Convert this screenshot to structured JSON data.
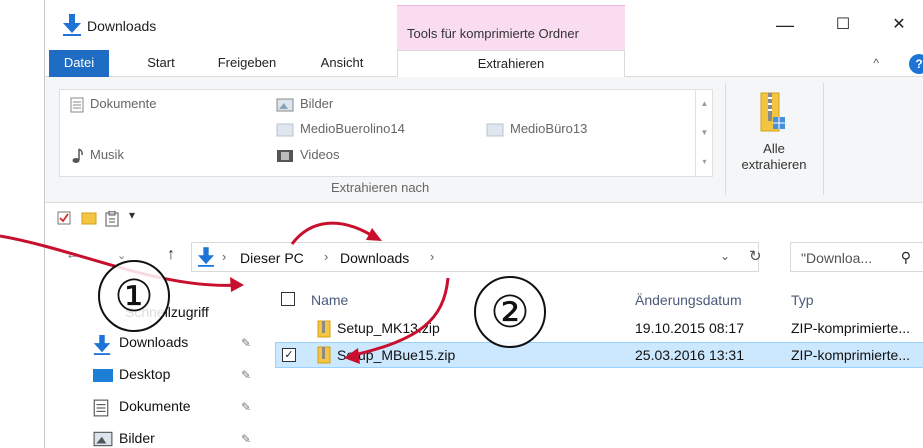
{
  "window": {
    "title": "Downloads",
    "context_tab": "Tools für komprimierte Ordner",
    "controls": {
      "minimize": "—",
      "maximize": "☐",
      "close": "✕"
    }
  },
  "ribbon_tabs": {
    "datei": "Datei",
    "start": "Start",
    "freigeben": "Freigeben",
    "ansicht": "Ansicht",
    "extrahieren": "Extrahieren",
    "collapse": "^",
    "help": "?"
  },
  "ribbon": {
    "gallery": {
      "dokumente": "Dokumente",
      "bilder": "Bilder",
      "mediobuerolino": "MedioBuerolino14",
      "mediobuero": "MedioBüro13",
      "musik": "Musik",
      "videos": "Videos"
    },
    "group_label": "Extrahieren nach",
    "extract_all_line1": "Alle",
    "extract_all_line2": "extrahieren"
  },
  "address": {
    "crumb1": "Dieser PC",
    "crumb2": "Downloads",
    "separator": "›",
    "search_placeholder": "\"Downloa..."
  },
  "nav": {
    "quick_access": "Schnellzugriff",
    "items": [
      {
        "label": "Downloads"
      },
      {
        "label": "Desktop"
      },
      {
        "label": "Dokumente"
      },
      {
        "label": "Bilder"
      }
    ]
  },
  "file_list": {
    "headers": {
      "name": "Name",
      "date": "Änderungsdatum",
      "type": "Typ"
    },
    "rows": [
      {
        "name": "Setup_MK13.zip",
        "date": "19.10.2015 08:17",
        "type": "ZIP-komprimierte..."
      },
      {
        "name": "Setup_MBue15.zip",
        "date": "25.03.2016 13:31",
        "type": "ZIP-komprimierte..."
      }
    ]
  },
  "annotations": {
    "step1": "①",
    "step2": "②"
  },
  "colors": {
    "accent": "#1e6cc3",
    "context_tab": "#fadcf1",
    "selection": "#cce8ff",
    "annotation": "#c8102e"
  }
}
